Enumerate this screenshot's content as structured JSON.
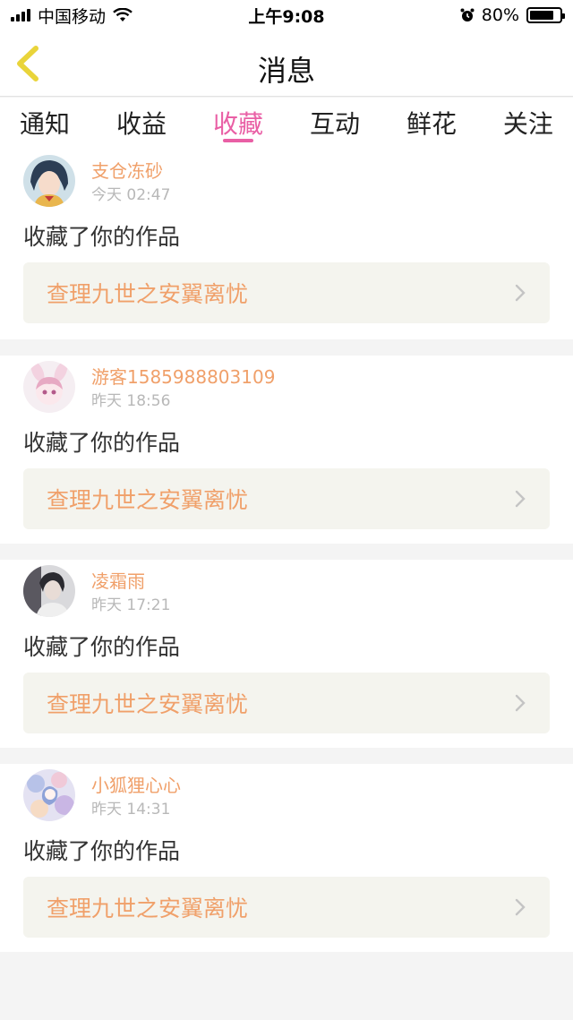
{
  "status_bar": {
    "carrier": "中国移动",
    "time": "上午9:08",
    "battery_percent": "80%",
    "battery_level": 0.8
  },
  "nav": {
    "title": "消息"
  },
  "tabs": [
    {
      "label": "通知",
      "active": false
    },
    {
      "label": "收益",
      "active": false
    },
    {
      "label": "收藏",
      "active": true
    },
    {
      "label": "互动",
      "active": false
    },
    {
      "label": "鲜花",
      "active": false
    },
    {
      "label": "关注",
      "active": false
    }
  ],
  "feed": [
    {
      "user": "支仓冻砂",
      "time": "今天 02:47",
      "action": "收藏了你的作品",
      "work": "查理九世之安翼离忧"
    },
    {
      "user": "游客1585988803109",
      "time": "昨天 18:56",
      "action": "收藏了你的作品",
      "work": "查理九世之安翼离忧"
    },
    {
      "user": "凌霜雨",
      "time": "昨天 17:21",
      "action": "收藏了你的作品",
      "work": "查理九世之安翼离忧"
    },
    {
      "user": "小狐狸心心",
      "time": "昨天 14:31",
      "action": "收藏了你的作品",
      "work": "查理九世之安翼离忧"
    }
  ],
  "colors": {
    "accent_pink": "#e95fa5",
    "accent_orange": "#f0a06a",
    "back_arrow": "#e9d43a"
  }
}
